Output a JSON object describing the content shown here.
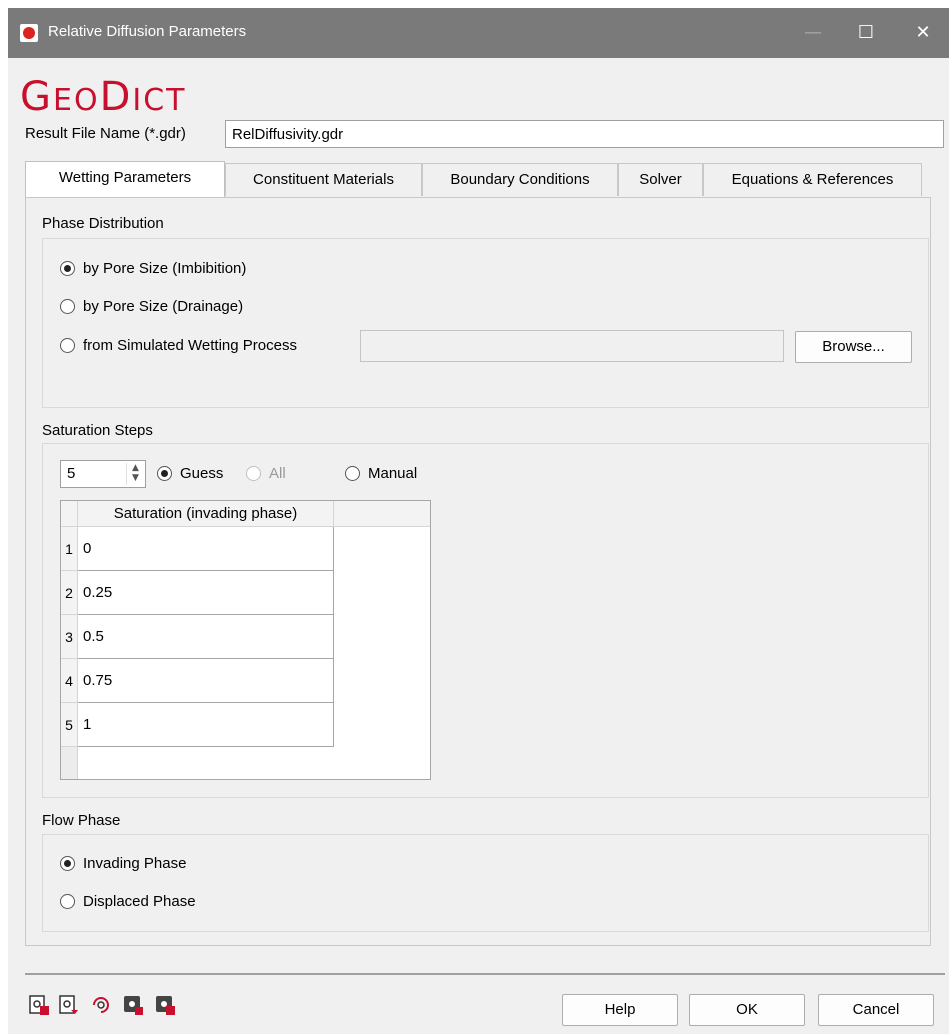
{
  "window": {
    "title": "Relative Diffusion Parameters",
    "minimize_glyph": "—",
    "maximize_glyph": "☐",
    "close_glyph": "✕"
  },
  "logo": {
    "part1": "G",
    "part2": "EO",
    "part3": "D",
    "part4": "ICT"
  },
  "result_file": {
    "label": "Result File Name (*.gdr)",
    "value": "RelDiffusivity.gdr"
  },
  "tabs": [
    {
      "label": "Wetting Parameters",
      "active": true
    },
    {
      "label": "Constituent Materials",
      "active": false
    },
    {
      "label": "Boundary Conditions",
      "active": false
    },
    {
      "label": "Solver",
      "active": false
    },
    {
      "label": "Equations & References",
      "active": false
    }
  ],
  "phase_distribution": {
    "title": "Phase Distribution",
    "options": [
      {
        "label": "by Pore Size (Imbibition)",
        "checked": true
      },
      {
        "label": "by Pore Size (Drainage)",
        "checked": false
      },
      {
        "label": "from Simulated Wetting Process",
        "checked": false
      }
    ],
    "file_value": "",
    "browse_label": "Browse..."
  },
  "saturation_steps": {
    "title": "Saturation Steps",
    "count": "5",
    "modes": [
      {
        "label": "Guess",
        "checked": true,
        "disabled": false
      },
      {
        "label": "All",
        "checked": false,
        "disabled": true
      },
      {
        "label": "Manual",
        "checked": false,
        "disabled": false
      }
    ],
    "table": {
      "column_header": "Saturation (invading phase)",
      "rows": [
        {
          "index": "1",
          "value": "0"
        },
        {
          "index": "2",
          "value": "0.25"
        },
        {
          "index": "3",
          "value": "0.5"
        },
        {
          "index": "4",
          "value": "0.75"
        },
        {
          "index": "5",
          "value": "1"
        }
      ]
    }
  },
  "flow_phase": {
    "title": "Flow Phase",
    "options": [
      {
        "label": "Invading Phase",
        "checked": true
      },
      {
        "label": "Displaced Phase",
        "checked": false
      }
    ]
  },
  "footer": {
    "tool_icons": [
      "load-settings-icon",
      "save-settings-icon",
      "reset-settings-icon",
      "run-script-icon",
      "export-settings-icon"
    ],
    "help_label": "Help",
    "ok_label": "OK",
    "cancel_label": "Cancel"
  },
  "colors": {
    "titlebar_bg": "#7a7a7a",
    "logo_red": "#c8102e",
    "dialog_bg": "#f0f0f0"
  }
}
